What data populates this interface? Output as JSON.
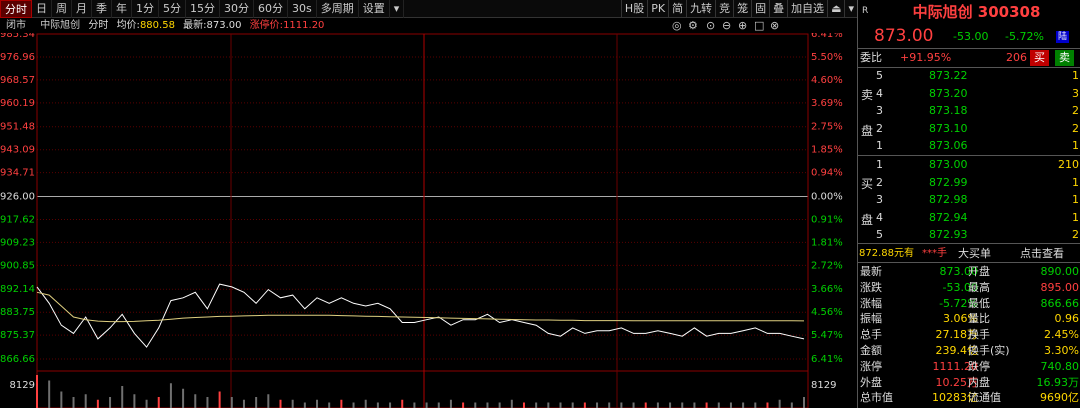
{
  "colors": {
    "up": "#ff4040",
    "down": "#00d000",
    "bg": "#000000",
    "grid": "#7a0000",
    "price_line": "#ffffff",
    "avg_line": "#e0d080",
    "volume": "#707070",
    "volume_up": "#ff4040"
  },
  "toolbar": {
    "periods": [
      "分时",
      "日",
      "周",
      "月",
      "季",
      "年",
      "1分",
      "5分",
      "15分",
      "30分",
      "60分",
      "30s",
      "多周期",
      "设置"
    ],
    "active": "分时",
    "right": [
      "H股",
      "PK",
      "简",
      "九转",
      "竞",
      "笼",
      "固",
      "叠",
      "加自选",
      "⏏"
    ],
    "dropdown_icon": "chevron-down-icon"
  },
  "info": {
    "status": "闭市",
    "name": "中际旭创",
    "mode": "分时",
    "avg_label": "均价:",
    "avg_value": "880.58",
    "last_label": "最新:",
    "last_value": "873.00",
    "limit_label": "涨停价:",
    "limit_value": "1111.20"
  },
  "axis": {
    "left": [
      "985.34",
      "976.96",
      "968.57",
      "960.19",
      "951.48",
      "943.09",
      "934.71",
      "926.00",
      "917.62",
      "909.23",
      "900.85",
      "892.14",
      "883.75",
      "875.37",
      "866.66"
    ],
    "right": [
      "6.41%",
      "5.50%",
      "4.60%",
      "3.69%",
      "2.75%",
      "1.85%",
      "0.94%",
      "0.00%",
      "0.91%",
      "1.81%",
      "2.72%",
      "3.66%",
      "4.56%",
      "5.47%",
      "6.41%"
    ],
    "vol_left": "8129",
    "vol_right": "8129"
  },
  "chart_data": {
    "type": "line",
    "title": "",
    "xlabel": "",
    "ylabel": "",
    "ylim": [
      866.66,
      985.34
    ],
    "prev_close": 926.0,
    "series": [
      {
        "name": "最新",
        "values": [
          893.0,
          887.0,
          879.0,
          876.0,
          882.0,
          874.0,
          878.0,
          883.0,
          876.0,
          871.0,
          878.0,
          888.0,
          889.0,
          891.0,
          885.0,
          894.0,
          893.0,
          891.0,
          887.0,
          892.0,
          889.0,
          890.0,
          885.0,
          889.0,
          887.0,
          889.0,
          887.0,
          886.0,
          887.0,
          885.0,
          880.0,
          880.0,
          881.0,
          882.0,
          879.0,
          881.0,
          881.0,
          883.0,
          880.0,
          881.0,
          880.0,
          879.0,
          876.0,
          875.0,
          878.0,
          876.0,
          877.0,
          877.0,
          878.0,
          876.0,
          876.0,
          877.0,
          876.0,
          875.0,
          878.0,
          875.0,
          876.0,
          876.0,
          877.0,
          878.0,
          876.0,
          876.0,
          875.0,
          874.0
        ]
      },
      {
        "name": "均价",
        "values": [
          891.0,
          890.0,
          886.0,
          882.0,
          881.0,
          880.5,
          880.3,
          880.3,
          880.4,
          880.6,
          880.8,
          881.2,
          881.6,
          881.8,
          882.0,
          882.2,
          882.3,
          882.4,
          882.5,
          882.6,
          882.6,
          882.6,
          882.6,
          882.6,
          882.6,
          882.5,
          882.4,
          882.3,
          882.2,
          882.1,
          882.0,
          881.9,
          881.8,
          881.7,
          881.6,
          881.5,
          881.4,
          881.3,
          881.2,
          881.1,
          881.0,
          880.9,
          880.9,
          880.8,
          880.8,
          880.7,
          880.7,
          880.7,
          880.7,
          880.6,
          880.6,
          880.6,
          880.6,
          880.6,
          880.6,
          880.6,
          880.6,
          880.6,
          880.6,
          880.6,
          880.6,
          880.6,
          880.6,
          880.58
        ]
      }
    ],
    "volume": [
      12,
      10,
      6,
      4,
      5,
      3,
      4,
      8,
      5,
      3,
      4,
      9,
      7,
      5,
      4,
      6,
      4,
      3,
      4,
      5,
      3,
      3,
      2,
      3,
      2,
      3,
      2,
      3,
      2,
      2,
      3,
      2,
      2,
      2,
      3,
      2,
      2,
      2,
      2,
      3,
      2,
      2,
      2,
      2,
      2,
      2,
      2,
      2,
      2,
      2,
      2,
      2,
      2,
      2,
      2,
      2,
      2,
      2,
      2,
      2,
      2,
      3,
      2,
      4
    ]
  },
  "quote": {
    "title": "中际旭创 300308",
    "r": "R",
    "price": "873.00",
    "change": "-53.00",
    "pct": "-5.72%",
    "market": "陆",
    "weibi_label": "委比",
    "weibi": "+91.95%",
    "weicha": "206",
    "buy_btn": "买",
    "sell_btn": "卖",
    "sell": [
      {
        "lvl": "5",
        "price": "873.22",
        "vol": "1"
      },
      {
        "lvl": "4",
        "price": "873.20",
        "vol": "3"
      },
      {
        "lvl": "3",
        "price": "873.18",
        "vol": "2"
      },
      {
        "lvl": "2",
        "price": "873.10",
        "vol": "2"
      },
      {
        "lvl": "1",
        "price": "873.06",
        "vol": "1"
      }
    ],
    "buy": [
      {
        "lvl": "1",
        "price": "873.00",
        "vol": "210"
      },
      {
        "lvl": "2",
        "price": "872.99",
        "vol": "1"
      },
      {
        "lvl": "3",
        "price": "872.98",
        "vol": "1"
      },
      {
        "lvl": "4",
        "price": "872.94",
        "vol": "1"
      },
      {
        "lvl": "5",
        "price": "872.93",
        "vol": "2"
      }
    ],
    "sell_label_chars": [
      "卖",
      "盘"
    ],
    "buy_label_chars": [
      "买",
      "盘"
    ],
    "bigorder": {
      "text1": "872.88元有",
      "text2": "***手",
      "text3": "大买单",
      "link": "点击查看"
    },
    "stats": [
      [
        "最新",
        "873.00",
        "开盘",
        "890.00"
      ],
      [
        "涨跌",
        "-53.00",
        "最高",
        "895.00"
      ],
      [
        "涨幅",
        "-5.72%",
        "最低",
        "866.66"
      ],
      [
        "振幅",
        "3.06%",
        "量比",
        "0.96"
      ],
      [
        "总手",
        "27.18万",
        "换手",
        "2.45%"
      ],
      [
        "金额",
        "239.4亿",
        "换手(实)",
        "3.30%"
      ],
      [
        "涨停",
        "1111.20",
        "跌停",
        "740.80"
      ],
      [
        "外盘",
        "10.25万",
        "内盘",
        "16.93万"
      ],
      [
        "总市值",
        "10283亿",
        "流通值",
        "9690亿"
      ]
    ]
  }
}
